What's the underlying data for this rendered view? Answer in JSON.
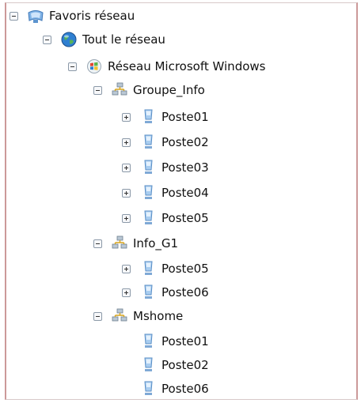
{
  "tree": {
    "root": {
      "label": "Favoris réseau",
      "icon": "network-places-icon",
      "expander": "minus"
    },
    "entire_network": {
      "label": "Tout le réseau",
      "icon": "globe-icon",
      "expander": "minus"
    },
    "windows_network": {
      "label": "Réseau Microsoft Windows",
      "icon": "windows-network-icon",
      "expander": "minus"
    },
    "workgroups": [
      {
        "label": "Groupe_Info",
        "icon": "workgroup-icon",
        "expander": "minus",
        "computers": [
          {
            "label": "Poste01",
            "icon": "computer-icon",
            "expander": "plus"
          },
          {
            "label": "Poste02",
            "icon": "computer-icon",
            "expander": "plus"
          },
          {
            "label": "Poste03",
            "icon": "computer-icon",
            "expander": "plus"
          },
          {
            "label": "Poste04",
            "icon": "computer-icon",
            "expander": "plus"
          },
          {
            "label": "Poste05",
            "icon": "computer-icon",
            "expander": "plus"
          }
        ]
      },
      {
        "label": "Info_G1",
        "icon": "workgroup-icon",
        "expander": "minus",
        "computers": [
          {
            "label": "Poste05",
            "icon": "computer-icon",
            "expander": "plus"
          },
          {
            "label": "Poste06",
            "icon": "computer-icon",
            "expander": "plus"
          }
        ]
      },
      {
        "label": "Mshome",
        "icon": "workgroup-icon",
        "expander": "minus",
        "computers": [
          {
            "label": "Poste01",
            "icon": "computer-icon",
            "expander": "none"
          },
          {
            "label": "Poste02",
            "icon": "computer-icon",
            "expander": "none"
          },
          {
            "label": "Poste06",
            "icon": "computer-icon",
            "expander": "none"
          }
        ]
      }
    ]
  },
  "colors": {
    "frame": "#cc9999",
    "expander_border": "#8b99a8",
    "text": "#111111"
  }
}
